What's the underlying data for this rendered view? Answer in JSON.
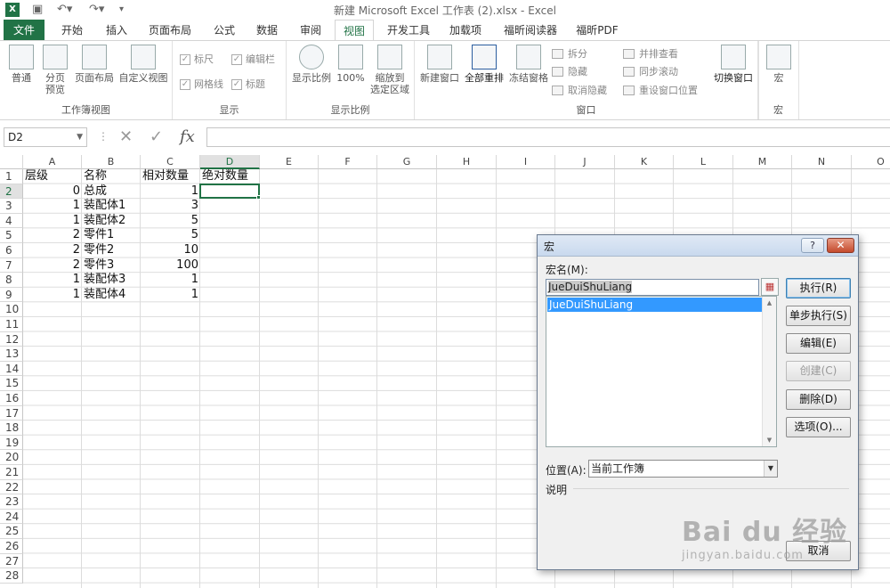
{
  "window": {
    "title": "新建 Microsoft Excel 工作表 (2).xlsx - Excel",
    "app_icon": "excel-icon"
  },
  "tabs": [
    "文件",
    "开始",
    "插入",
    "页面布局",
    "公式",
    "数据",
    "审阅",
    "视图",
    "开发工具",
    "加载项",
    "福昕阅读器",
    "福昕PDF"
  ],
  "active_tab": "视图",
  "ribbon": {
    "workbook_views": {
      "label": "工作簿视图",
      "buttons": [
        "普通",
        "分页\n预览",
        "页面布局",
        "自定义视图"
      ]
    },
    "show": {
      "label": "显示",
      "ruler": "标尺",
      "formula_bar": "编辑栏",
      "gridlines": "网格线",
      "headings": "标题"
    },
    "zoom": {
      "label": "显示比例",
      "buttons": [
        "显示比例",
        "100%",
        "缩放到\n选定区域"
      ]
    },
    "window": {
      "label": "窗口",
      "new_window": "新建窗口",
      "arrange_all": "全部重排",
      "freeze": "冻结窗格",
      "split": "拆分",
      "hide": "隐藏",
      "unhide": "取消隐藏",
      "side_by_side": "并排查看",
      "sync_scroll": "同步滚动",
      "reset_pos": "重设窗口位置",
      "switch": "切换窗口"
    },
    "macros": {
      "label": "宏",
      "button": "宏"
    }
  },
  "formula_bar": {
    "name_box": "D2",
    "fx": "fx",
    "formula": ""
  },
  "grid": {
    "columns": [
      "A",
      "B",
      "C",
      "D",
      "E",
      "F",
      "G",
      "H",
      "I",
      "J",
      "K",
      "L",
      "M",
      "N",
      "O"
    ],
    "rows": [
      "1",
      "2",
      "3",
      "4",
      "5",
      "6",
      "7",
      "8",
      "9",
      "10",
      "11",
      "12",
      "13",
      "14",
      "15",
      "16",
      "17",
      "18",
      "19",
      "20",
      "21",
      "22",
      "23",
      "24",
      "25",
      "26",
      "27",
      "28"
    ],
    "selected_cell": "D2",
    "cells": [
      {
        "r": 1,
        "c": "A",
        "v": "层级",
        "t": "text"
      },
      {
        "r": 1,
        "c": "B",
        "v": "名称",
        "t": "text"
      },
      {
        "r": 1,
        "c": "C",
        "v": "相对数量",
        "t": "text"
      },
      {
        "r": 1,
        "c": "D",
        "v": "绝对数量",
        "t": "text"
      },
      {
        "r": 2,
        "c": "A",
        "v": "0",
        "t": "num"
      },
      {
        "r": 2,
        "c": "B",
        "v": "总成",
        "t": "text"
      },
      {
        "r": 2,
        "c": "C",
        "v": "1",
        "t": "num"
      },
      {
        "r": 3,
        "c": "A",
        "v": "1",
        "t": "num"
      },
      {
        "r": 3,
        "c": "B",
        "v": "装配体1",
        "t": "text"
      },
      {
        "r": 3,
        "c": "C",
        "v": "3",
        "t": "num"
      },
      {
        "r": 4,
        "c": "A",
        "v": "1",
        "t": "num"
      },
      {
        "r": 4,
        "c": "B",
        "v": "装配体2",
        "t": "text"
      },
      {
        "r": 4,
        "c": "C",
        "v": "5",
        "t": "num"
      },
      {
        "r": 5,
        "c": "A",
        "v": "2",
        "t": "num"
      },
      {
        "r": 5,
        "c": "B",
        "v": "零件1",
        "t": "text"
      },
      {
        "r": 5,
        "c": "C",
        "v": "5",
        "t": "num"
      },
      {
        "r": 6,
        "c": "A",
        "v": "2",
        "t": "num"
      },
      {
        "r": 6,
        "c": "B",
        "v": "零件2",
        "t": "text"
      },
      {
        "r": 6,
        "c": "C",
        "v": "10",
        "t": "num"
      },
      {
        "r": 7,
        "c": "A",
        "v": "2",
        "t": "num"
      },
      {
        "r": 7,
        "c": "B",
        "v": "零件3",
        "t": "text"
      },
      {
        "r": 7,
        "c": "C",
        "v": "100",
        "t": "num"
      },
      {
        "r": 8,
        "c": "A",
        "v": "1",
        "t": "num"
      },
      {
        "r": 8,
        "c": "B",
        "v": "装配体3",
        "t": "text"
      },
      {
        "r": 8,
        "c": "C",
        "v": "1",
        "t": "num"
      },
      {
        "r": 9,
        "c": "A",
        "v": "1",
        "t": "num"
      },
      {
        "r": 9,
        "c": "B",
        "v": "装配体4",
        "t": "text"
      },
      {
        "r": 9,
        "c": "C",
        "v": "1",
        "t": "num"
      }
    ]
  },
  "dialog": {
    "title": "宏",
    "help": "?",
    "close": "✕",
    "macro_name_label": "宏名(M):",
    "macro_name_value": "JueDuiShuLiang",
    "macro_list": [
      "JueDuiShuLiang"
    ],
    "buttons": {
      "run": "执行(R)",
      "step": "单步执行(S)",
      "edit": "编辑(E)",
      "create": "创建(C)",
      "delete": "删除(D)",
      "options": "选项(O)...",
      "cancel": "取消"
    },
    "location_label": "位置(A):",
    "location_value": "当前工作簿",
    "description_label": "说明"
  },
  "watermark": {
    "main": "Bai du 经验",
    "sub": "jingyan.baidu.com"
  }
}
